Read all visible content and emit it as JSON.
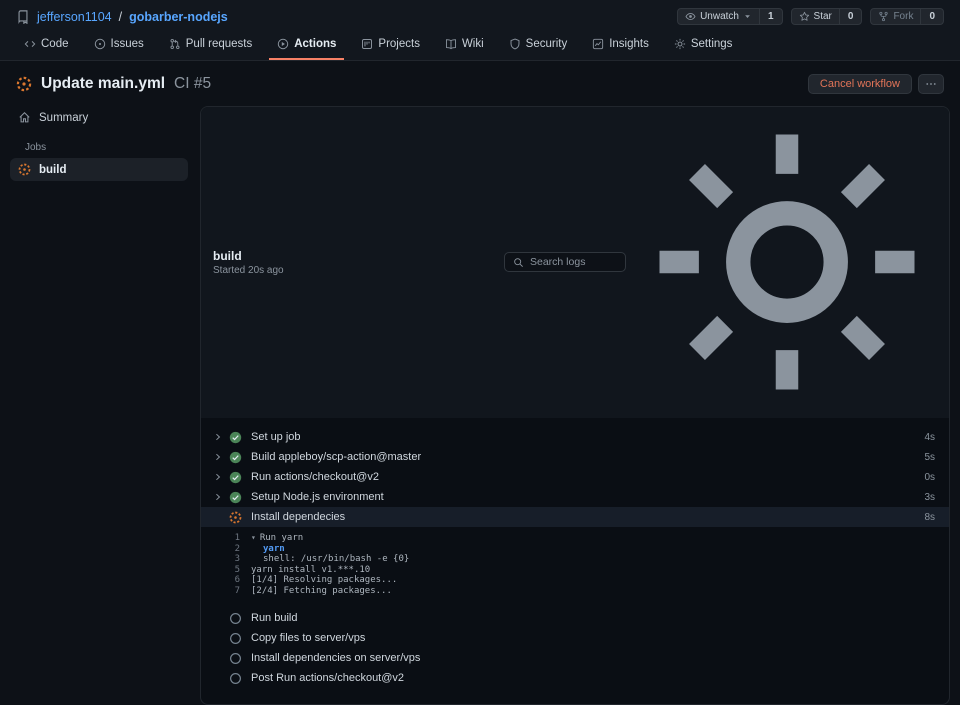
{
  "colors": {
    "accent_blue": "#58a6ff",
    "tab_underline": "#f78166",
    "success_green": "#4b8558",
    "progress_orange": "#d9772f",
    "danger_text": "#e27458",
    "command_blue": "#539bf5"
  },
  "header": {
    "repo_owner": "jefferson1104",
    "separator": "/",
    "repo_name": "gobarber-nodejs",
    "action_buttons": [
      {
        "label": "Unwatch",
        "count": "1",
        "icon": "eye-icon",
        "caret": true,
        "muted": false
      },
      {
        "label": "Star",
        "count": "0",
        "icon": "star-icon",
        "caret": false,
        "muted": false
      },
      {
        "label": "Fork",
        "count": "0",
        "icon": "fork-icon",
        "caret": false,
        "muted": true
      }
    ]
  },
  "nav_tabs": [
    {
      "label": "Code",
      "icon": "code-icon",
      "active": false
    },
    {
      "label": "Issues",
      "icon": "issue-icon",
      "active": false
    },
    {
      "label": "Pull requests",
      "icon": "pull-request-icon",
      "active": false
    },
    {
      "label": "Actions",
      "icon": "actions-icon",
      "active": true
    },
    {
      "label": "Projects",
      "icon": "projects-icon",
      "active": false
    },
    {
      "label": "Wiki",
      "icon": "wiki-icon",
      "active": false
    },
    {
      "label": "Security",
      "icon": "security-icon",
      "active": false
    },
    {
      "label": "Insights",
      "icon": "insights-icon",
      "active": false
    },
    {
      "label": "Settings",
      "icon": "settings-icon",
      "active": false
    }
  ],
  "run_header": {
    "title": "Update main.yml",
    "run_label": "CI #5",
    "cancel_button_label": "Cancel workflow"
  },
  "sidebar": {
    "summary_label": "Summary",
    "jobs_section_label": "Jobs",
    "jobs": [
      {
        "name": "build",
        "status": "in_progress",
        "selected": true
      }
    ]
  },
  "job_panel": {
    "job_name": "build",
    "started_text": "Started 20s ago",
    "search_placeholder": "Search logs",
    "steps": [
      {
        "name": "Set up job",
        "duration": "4s",
        "status": "success"
      },
      {
        "name": "Build appleboy/scp-action@master",
        "duration": "5s",
        "status": "success"
      },
      {
        "name": "Run actions/checkout@v2",
        "duration": "0s",
        "status": "success"
      },
      {
        "name": "Setup Node.js environment",
        "duration": "3s",
        "status": "success"
      },
      {
        "name": "Install dependecies",
        "duration": "8s",
        "status": "in_progress",
        "log_lines": [
          {
            "num": "1",
            "text": "Run yarn",
            "kind": "group"
          },
          {
            "num": "2",
            "text": "yarn",
            "kind": "command"
          },
          {
            "num": "3",
            "text": "shell: /usr/bin/bash -e {0}",
            "kind": "meta"
          },
          {
            "num": "5",
            "text": "yarn install v1.***.10",
            "kind": "output"
          },
          {
            "num": "6",
            "text": "[1/4] Resolving packages...",
            "kind": "output"
          },
          {
            "num": "7",
            "text": "[2/4] Fetching packages...",
            "kind": "output"
          }
        ]
      },
      {
        "name": "Run build",
        "duration": "",
        "status": "pending"
      },
      {
        "name": "Copy files to server/vps",
        "duration": "",
        "status": "pending"
      },
      {
        "name": "Install dependencies on server/vps",
        "duration": "",
        "status": "pending"
      },
      {
        "name": "Post Run actions/checkout@v2",
        "duration": "",
        "status": "pending"
      }
    ]
  }
}
